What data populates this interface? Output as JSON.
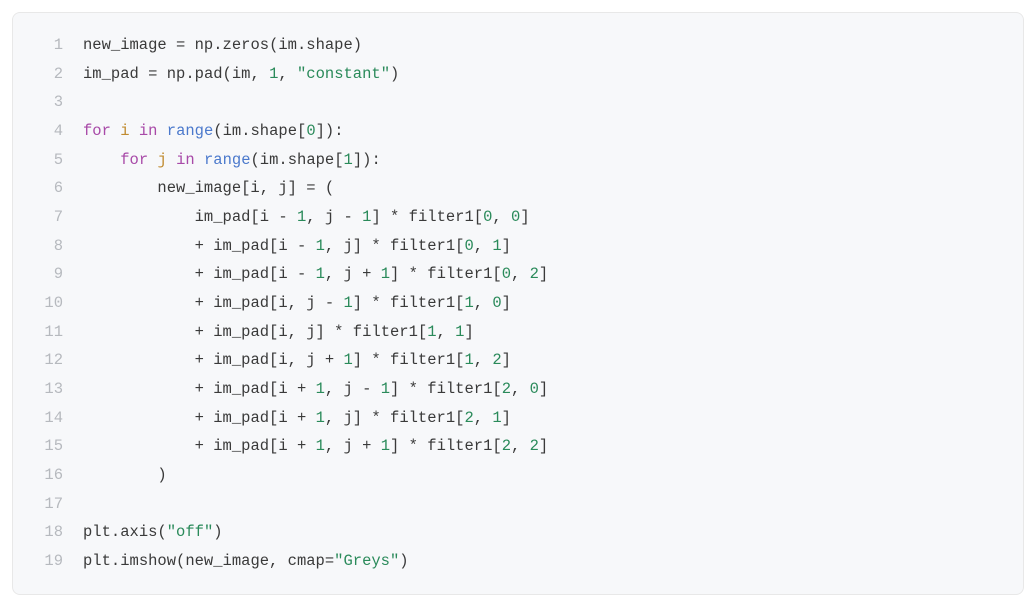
{
  "code": {
    "lines": [
      {
        "n": "1",
        "tokens": [
          {
            "t": "new_image ",
            "c": "pn"
          },
          {
            "t": "=",
            "c": "op"
          },
          {
            "t": " np",
            "c": "pn"
          },
          {
            "t": ".",
            "c": "pn"
          },
          {
            "t": "zeros",
            "c": "pn"
          },
          {
            "t": "(im",
            "c": "pn"
          },
          {
            "t": ".",
            "c": "pn"
          },
          {
            "t": "shape)",
            "c": "pn"
          }
        ]
      },
      {
        "n": "2",
        "tokens": [
          {
            "t": "im_pad ",
            "c": "pn"
          },
          {
            "t": "=",
            "c": "op"
          },
          {
            "t": " np",
            "c": "pn"
          },
          {
            "t": ".",
            "c": "pn"
          },
          {
            "t": "pad(im, ",
            "c": "pn"
          },
          {
            "t": "1",
            "c": "num"
          },
          {
            "t": ", ",
            "c": "pn"
          },
          {
            "t": "\"constant\"",
            "c": "str"
          },
          {
            "t": ")",
            "c": "pn"
          }
        ]
      },
      {
        "n": "3",
        "tokens": [
          {
            "t": "",
            "c": "pn"
          }
        ]
      },
      {
        "n": "4",
        "tokens": [
          {
            "t": "for",
            "c": "kw"
          },
          {
            "t": " ",
            "c": "pn"
          },
          {
            "t": "i",
            "c": "nm"
          },
          {
            "t": " ",
            "c": "pn"
          },
          {
            "t": "in",
            "c": "kw"
          },
          {
            "t": " ",
            "c": "pn"
          },
          {
            "t": "range",
            "c": "fn"
          },
          {
            "t": "(im",
            "c": "pn"
          },
          {
            "t": ".",
            "c": "pn"
          },
          {
            "t": "shape[",
            "c": "pn"
          },
          {
            "t": "0",
            "c": "num"
          },
          {
            "t": "]):",
            "c": "pn"
          }
        ]
      },
      {
        "n": "5",
        "tokens": [
          {
            "t": "    ",
            "c": "pn"
          },
          {
            "t": "for",
            "c": "kw"
          },
          {
            "t": " ",
            "c": "pn"
          },
          {
            "t": "j",
            "c": "nm"
          },
          {
            "t": " ",
            "c": "pn"
          },
          {
            "t": "in",
            "c": "kw"
          },
          {
            "t": " ",
            "c": "pn"
          },
          {
            "t": "range",
            "c": "fn"
          },
          {
            "t": "(im",
            "c": "pn"
          },
          {
            "t": ".",
            "c": "pn"
          },
          {
            "t": "shape[",
            "c": "pn"
          },
          {
            "t": "1",
            "c": "num"
          },
          {
            "t": "]):",
            "c": "pn"
          }
        ]
      },
      {
        "n": "6",
        "tokens": [
          {
            "t": "        new_image[i, j] ",
            "c": "pn"
          },
          {
            "t": "=",
            "c": "op"
          },
          {
            "t": " (",
            "c": "pn"
          }
        ]
      },
      {
        "n": "7",
        "tokens": [
          {
            "t": "            im_pad[i ",
            "c": "pn"
          },
          {
            "t": "-",
            "c": "op"
          },
          {
            "t": " ",
            "c": "pn"
          },
          {
            "t": "1",
            "c": "num"
          },
          {
            "t": ", j ",
            "c": "pn"
          },
          {
            "t": "-",
            "c": "op"
          },
          {
            "t": " ",
            "c": "pn"
          },
          {
            "t": "1",
            "c": "num"
          },
          {
            "t": "] ",
            "c": "pn"
          },
          {
            "t": "*",
            "c": "op"
          },
          {
            "t": " filter1[",
            "c": "pn"
          },
          {
            "t": "0",
            "c": "num"
          },
          {
            "t": ", ",
            "c": "pn"
          },
          {
            "t": "0",
            "c": "num"
          },
          {
            "t": "]",
            "c": "pn"
          }
        ]
      },
      {
        "n": "8",
        "tokens": [
          {
            "t": "            ",
            "c": "pn"
          },
          {
            "t": "+",
            "c": "op"
          },
          {
            "t": " im_pad[i ",
            "c": "pn"
          },
          {
            "t": "-",
            "c": "op"
          },
          {
            "t": " ",
            "c": "pn"
          },
          {
            "t": "1",
            "c": "num"
          },
          {
            "t": ", j] ",
            "c": "pn"
          },
          {
            "t": "*",
            "c": "op"
          },
          {
            "t": " filter1[",
            "c": "pn"
          },
          {
            "t": "0",
            "c": "num"
          },
          {
            "t": ", ",
            "c": "pn"
          },
          {
            "t": "1",
            "c": "num"
          },
          {
            "t": "]",
            "c": "pn"
          }
        ]
      },
      {
        "n": "9",
        "tokens": [
          {
            "t": "            ",
            "c": "pn"
          },
          {
            "t": "+",
            "c": "op"
          },
          {
            "t": " im_pad[i ",
            "c": "pn"
          },
          {
            "t": "-",
            "c": "op"
          },
          {
            "t": " ",
            "c": "pn"
          },
          {
            "t": "1",
            "c": "num"
          },
          {
            "t": ", j ",
            "c": "pn"
          },
          {
            "t": "+",
            "c": "op"
          },
          {
            "t": " ",
            "c": "pn"
          },
          {
            "t": "1",
            "c": "num"
          },
          {
            "t": "] ",
            "c": "pn"
          },
          {
            "t": "*",
            "c": "op"
          },
          {
            "t": " filter1[",
            "c": "pn"
          },
          {
            "t": "0",
            "c": "num"
          },
          {
            "t": ", ",
            "c": "pn"
          },
          {
            "t": "2",
            "c": "num"
          },
          {
            "t": "]",
            "c": "pn"
          }
        ]
      },
      {
        "n": "10",
        "tokens": [
          {
            "t": "            ",
            "c": "pn"
          },
          {
            "t": "+",
            "c": "op"
          },
          {
            "t": " im_pad[i, j ",
            "c": "pn"
          },
          {
            "t": "-",
            "c": "op"
          },
          {
            "t": " ",
            "c": "pn"
          },
          {
            "t": "1",
            "c": "num"
          },
          {
            "t": "] ",
            "c": "pn"
          },
          {
            "t": "*",
            "c": "op"
          },
          {
            "t": " filter1[",
            "c": "pn"
          },
          {
            "t": "1",
            "c": "num"
          },
          {
            "t": ", ",
            "c": "pn"
          },
          {
            "t": "0",
            "c": "num"
          },
          {
            "t": "]",
            "c": "pn"
          }
        ]
      },
      {
        "n": "11",
        "tokens": [
          {
            "t": "            ",
            "c": "pn"
          },
          {
            "t": "+",
            "c": "op"
          },
          {
            "t": " im_pad[i, j] ",
            "c": "pn"
          },
          {
            "t": "*",
            "c": "op"
          },
          {
            "t": " filter1[",
            "c": "pn"
          },
          {
            "t": "1",
            "c": "num"
          },
          {
            "t": ", ",
            "c": "pn"
          },
          {
            "t": "1",
            "c": "num"
          },
          {
            "t": "]",
            "c": "pn"
          }
        ]
      },
      {
        "n": "12",
        "tokens": [
          {
            "t": "            ",
            "c": "pn"
          },
          {
            "t": "+",
            "c": "op"
          },
          {
            "t": " im_pad[i, j ",
            "c": "pn"
          },
          {
            "t": "+",
            "c": "op"
          },
          {
            "t": " ",
            "c": "pn"
          },
          {
            "t": "1",
            "c": "num"
          },
          {
            "t": "] ",
            "c": "pn"
          },
          {
            "t": "*",
            "c": "op"
          },
          {
            "t": " filter1[",
            "c": "pn"
          },
          {
            "t": "1",
            "c": "num"
          },
          {
            "t": ", ",
            "c": "pn"
          },
          {
            "t": "2",
            "c": "num"
          },
          {
            "t": "]",
            "c": "pn"
          }
        ]
      },
      {
        "n": "13",
        "tokens": [
          {
            "t": "            ",
            "c": "pn"
          },
          {
            "t": "+",
            "c": "op"
          },
          {
            "t": " im_pad[i ",
            "c": "pn"
          },
          {
            "t": "+",
            "c": "op"
          },
          {
            "t": " ",
            "c": "pn"
          },
          {
            "t": "1",
            "c": "num"
          },
          {
            "t": ", j ",
            "c": "pn"
          },
          {
            "t": "-",
            "c": "op"
          },
          {
            "t": " ",
            "c": "pn"
          },
          {
            "t": "1",
            "c": "num"
          },
          {
            "t": "] ",
            "c": "pn"
          },
          {
            "t": "*",
            "c": "op"
          },
          {
            "t": " filter1[",
            "c": "pn"
          },
          {
            "t": "2",
            "c": "num"
          },
          {
            "t": ", ",
            "c": "pn"
          },
          {
            "t": "0",
            "c": "num"
          },
          {
            "t": "]",
            "c": "pn"
          }
        ]
      },
      {
        "n": "14",
        "tokens": [
          {
            "t": "            ",
            "c": "pn"
          },
          {
            "t": "+",
            "c": "op"
          },
          {
            "t": " im_pad[i ",
            "c": "pn"
          },
          {
            "t": "+",
            "c": "op"
          },
          {
            "t": " ",
            "c": "pn"
          },
          {
            "t": "1",
            "c": "num"
          },
          {
            "t": ", j] ",
            "c": "pn"
          },
          {
            "t": "*",
            "c": "op"
          },
          {
            "t": " filter1[",
            "c": "pn"
          },
          {
            "t": "2",
            "c": "num"
          },
          {
            "t": ", ",
            "c": "pn"
          },
          {
            "t": "1",
            "c": "num"
          },
          {
            "t": "]",
            "c": "pn"
          }
        ]
      },
      {
        "n": "15",
        "tokens": [
          {
            "t": "            ",
            "c": "pn"
          },
          {
            "t": "+",
            "c": "op"
          },
          {
            "t": " im_pad[i ",
            "c": "pn"
          },
          {
            "t": "+",
            "c": "op"
          },
          {
            "t": " ",
            "c": "pn"
          },
          {
            "t": "1",
            "c": "num"
          },
          {
            "t": ", j ",
            "c": "pn"
          },
          {
            "t": "+",
            "c": "op"
          },
          {
            "t": " ",
            "c": "pn"
          },
          {
            "t": "1",
            "c": "num"
          },
          {
            "t": "] ",
            "c": "pn"
          },
          {
            "t": "*",
            "c": "op"
          },
          {
            "t": " filter1[",
            "c": "pn"
          },
          {
            "t": "2",
            "c": "num"
          },
          {
            "t": ", ",
            "c": "pn"
          },
          {
            "t": "2",
            "c": "num"
          },
          {
            "t": "]",
            "c": "pn"
          }
        ]
      },
      {
        "n": "16",
        "tokens": [
          {
            "t": "        )",
            "c": "pn"
          }
        ]
      },
      {
        "n": "17",
        "tokens": [
          {
            "t": "",
            "c": "pn"
          }
        ]
      },
      {
        "n": "18",
        "tokens": [
          {
            "t": "plt",
            "c": "pn"
          },
          {
            "t": ".",
            "c": "pn"
          },
          {
            "t": "axis(",
            "c": "pn"
          },
          {
            "t": "\"off\"",
            "c": "str"
          },
          {
            "t": ")",
            "c": "pn"
          }
        ]
      },
      {
        "n": "19",
        "tokens": [
          {
            "t": "plt",
            "c": "pn"
          },
          {
            "t": ".",
            "c": "pn"
          },
          {
            "t": "imshow(new_image, cmap",
            "c": "pn"
          },
          {
            "t": "=",
            "c": "op"
          },
          {
            "t": "\"Greys\"",
            "c": "str"
          },
          {
            "t": ")",
            "c": "pn"
          }
        ]
      }
    ]
  }
}
